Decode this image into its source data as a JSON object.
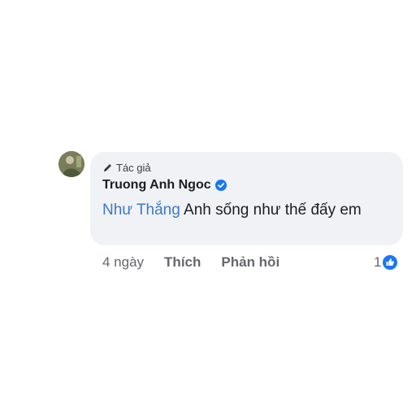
{
  "comment": {
    "author_badge": "Tác giả",
    "author_badge_icon": "pencil-icon",
    "author_name": "Truong Anh Ngoc",
    "verified_icon": "verified-badge-icon",
    "mention": "Như Thắng",
    "text": " Anh sống như thế đấy em"
  },
  "actions": {
    "time": "4 ngày",
    "like_label": "Thích",
    "reply_label": "Phản hồi"
  },
  "reactions": {
    "count": "1",
    "icon": "like-reaction-icon"
  },
  "colors": {
    "bubble": "#f0f2f5",
    "mention": "#3f79c8",
    "verified": "#1877f2",
    "meta_text": "#65676b"
  }
}
